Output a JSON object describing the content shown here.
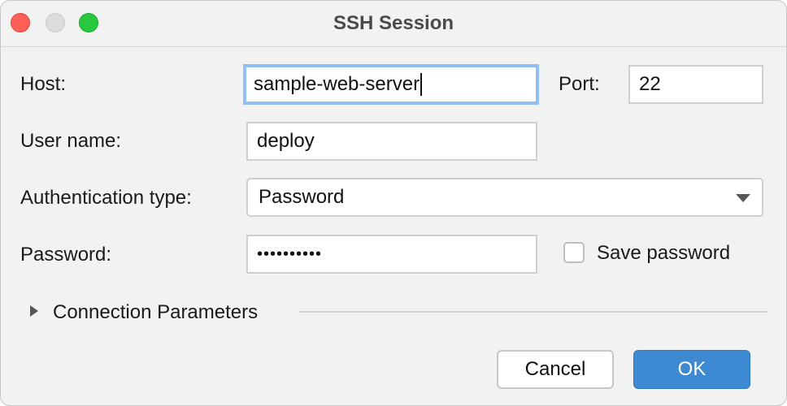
{
  "window": {
    "title": "SSH Session",
    "controls": {
      "close": "#fe5f57",
      "minimize": "#dcdcdc",
      "maximize": "#28c840"
    }
  },
  "form": {
    "host": {
      "label": "Host:",
      "value": "sample-web-server"
    },
    "port": {
      "label": "Port:",
      "value": "22"
    },
    "username": {
      "label": "User name:",
      "value": "deploy"
    },
    "auth": {
      "label": "Authentication type:",
      "value": "Password"
    },
    "password": {
      "label": "Password:",
      "value": "••••••••••"
    },
    "save_password": {
      "label": "Save password",
      "checked": false
    },
    "connection_parameters": {
      "label": "Connection Parameters",
      "expanded": false
    }
  },
  "buttons": {
    "cancel": "Cancel",
    "ok": "OK"
  },
  "colors": {
    "accent": "#3d8ad2",
    "focus": "#8fc0f4"
  }
}
